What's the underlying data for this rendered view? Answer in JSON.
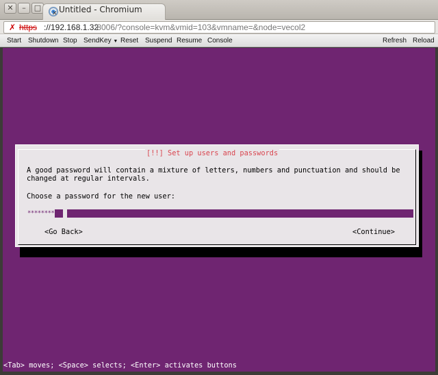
{
  "window": {
    "title": "Untitled - Chromium"
  },
  "address": {
    "scheme": "https",
    "host": "://192.168.1.32",
    "path": ":8006/?console=kvm&vmid=103&vmname=&node=vecol2"
  },
  "toolbar": {
    "start": "Start",
    "shutdown": "Shutdown",
    "stop": "Stop",
    "sendkey": "SendKey",
    "reset": "Reset",
    "suspend": "Suspend",
    "resume": "Resume",
    "console": "Console",
    "refresh": "Refresh",
    "reload": "Reload"
  },
  "dialog": {
    "title": "[!!] Set up users and passwords",
    "line1": "A good password will contain a mixture of letters, numbers and punctuation and should be",
    "line2": "changed at regular intervals.",
    "prompt": "Choose a password for the new user:",
    "password_mask": "********",
    "back_button": "<Go Back>",
    "continue_button": "<Continue>"
  },
  "status_line": "<Tab> moves; <Space> selects; <Enter> activates buttons",
  "colors": {
    "console_bg": "#6f2571",
    "dialog_bg": "#e9e5e8",
    "title_red": "#d9454f"
  }
}
